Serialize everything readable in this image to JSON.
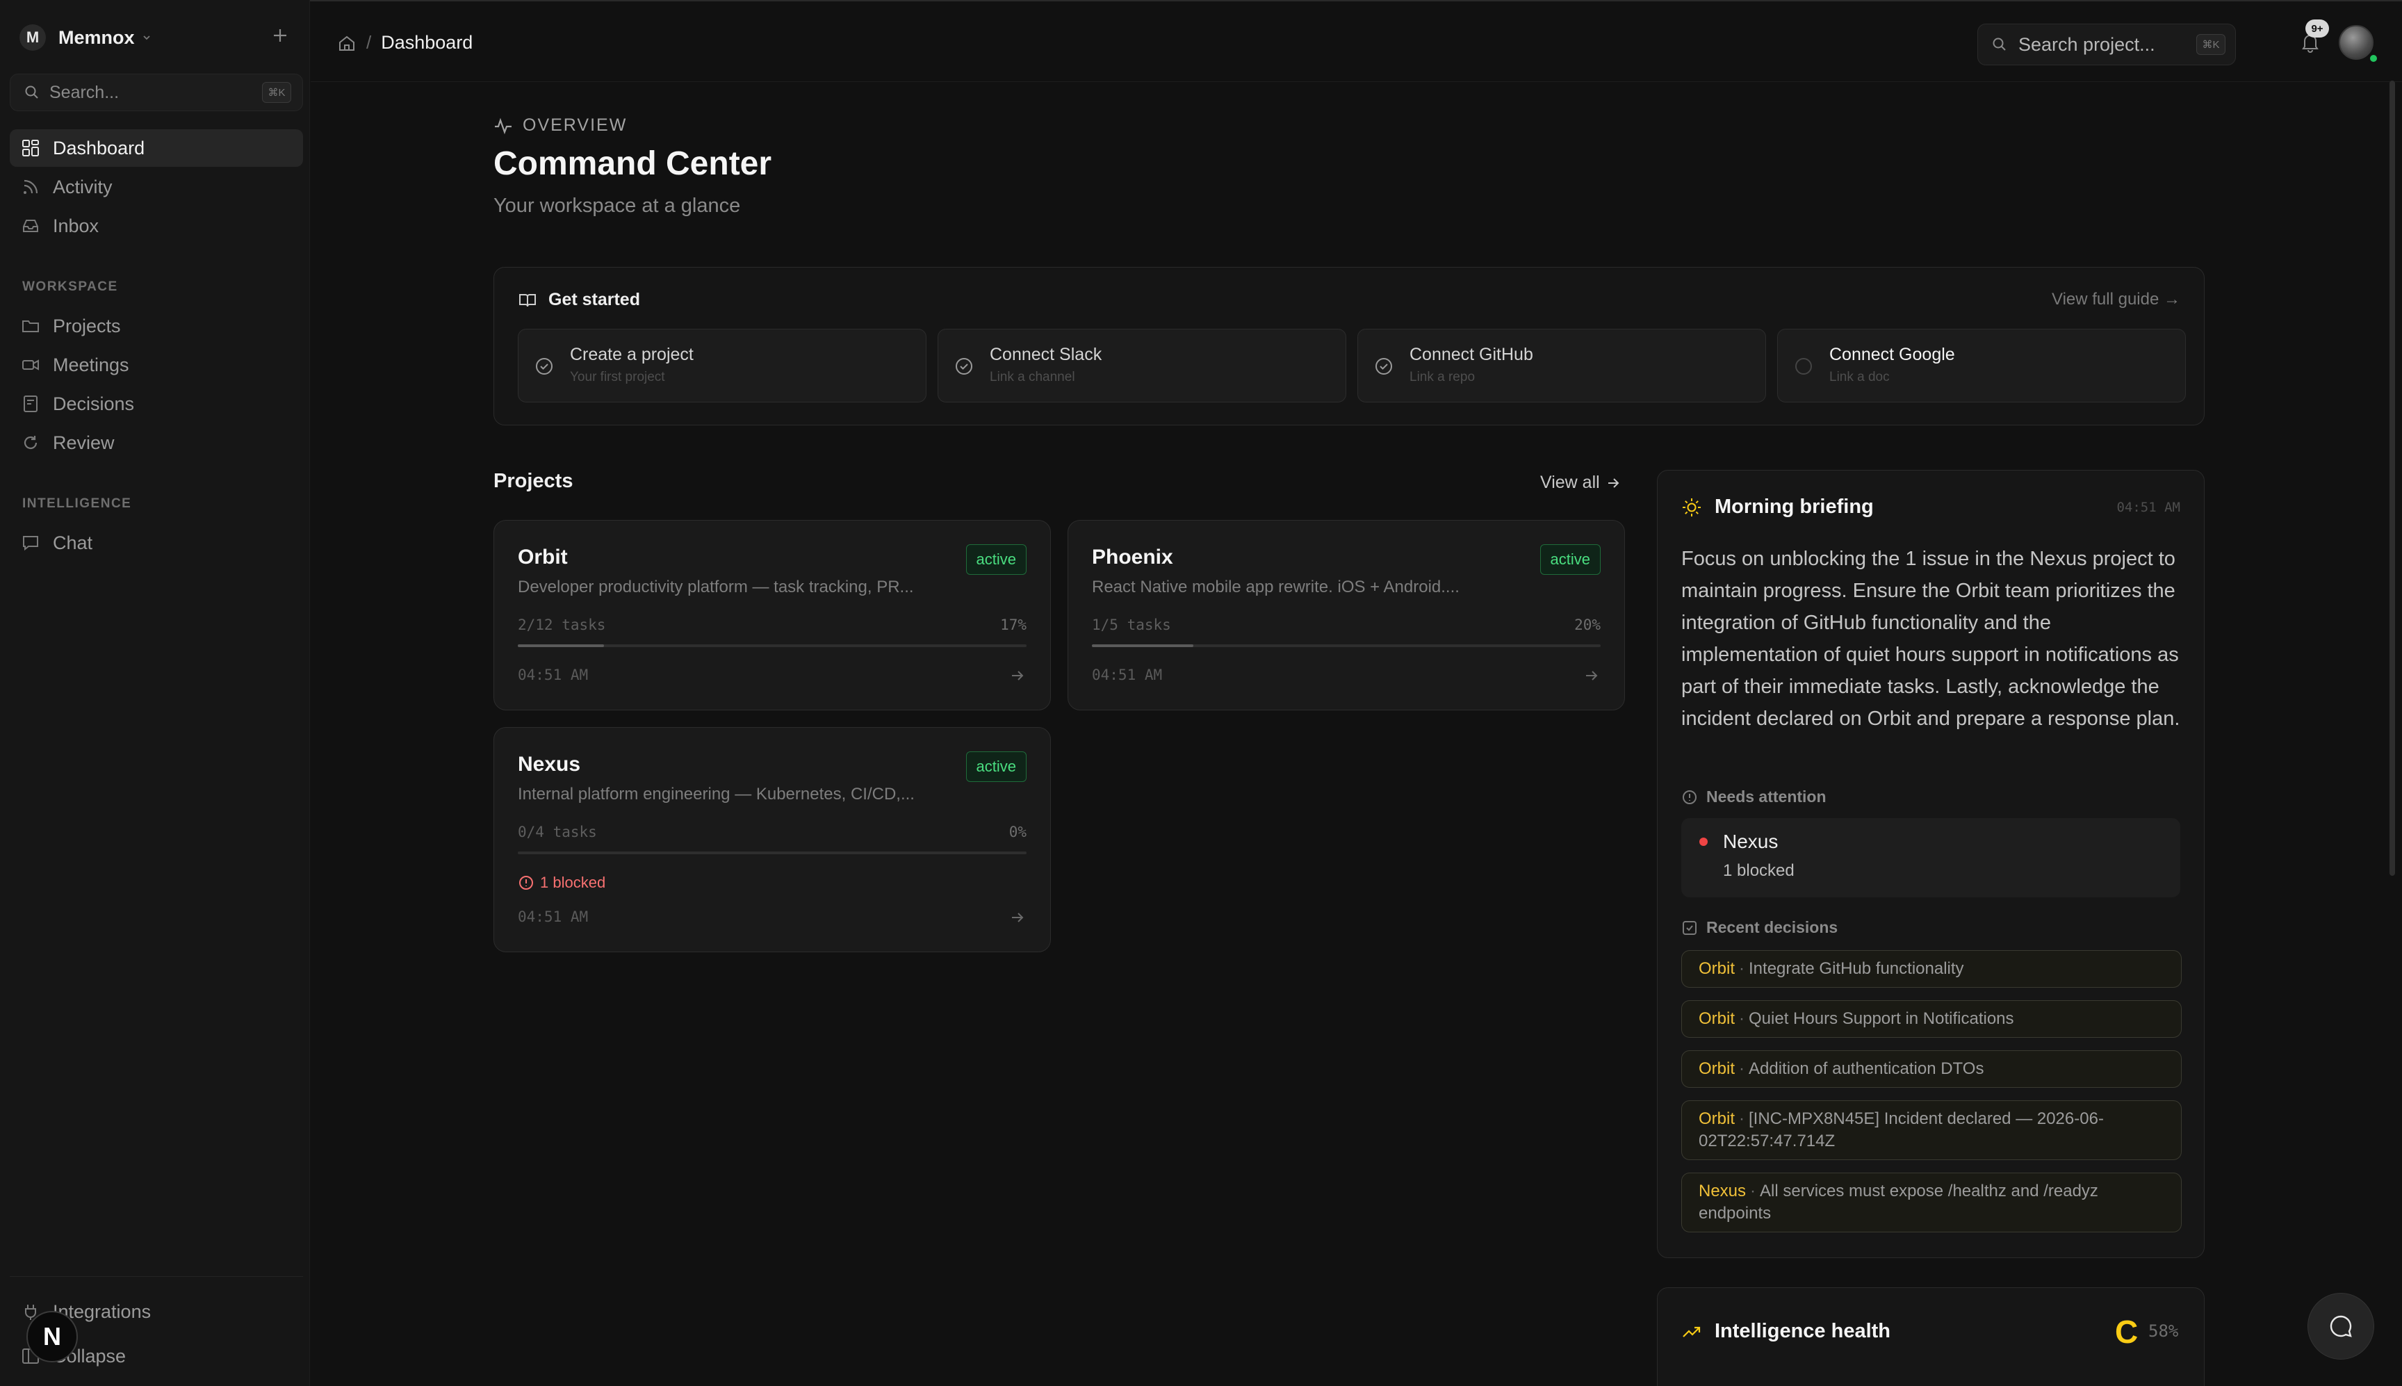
{
  "workspace": {
    "initial": "M",
    "name": "Memnox"
  },
  "sidebar": {
    "search_placeholder": "Search...",
    "search_shortcut": "⌘K",
    "primary": [
      {
        "label": "Dashboard",
        "icon": "grid-icon",
        "active": true
      },
      {
        "label": "Activity",
        "icon": "rss-icon"
      },
      {
        "label": "Inbox",
        "icon": "inbox-icon"
      }
    ],
    "workspace_label": "WORKSPACE",
    "workspace_items": [
      {
        "label": "Projects",
        "icon": "folder-icon"
      },
      {
        "label": "Meetings",
        "icon": "video-icon"
      },
      {
        "label": "Decisions",
        "icon": "bookmark-icon"
      },
      {
        "label": "Review",
        "icon": "refresh-icon"
      }
    ],
    "intelligence_label": "INTELLIGENCE",
    "intelligence_items": [
      {
        "label": "Chat",
        "icon": "message-icon"
      }
    ],
    "footer": {
      "integrations": "Integrations",
      "collapse": "Collapse"
    }
  },
  "topbar": {
    "breadcrumb_current": "Dashboard",
    "search_placeholder": "Search project...",
    "search_shortcut": "⌘K",
    "notification_count": "9+"
  },
  "header": {
    "eyebrow": "OVERVIEW",
    "title": "Command Center",
    "subtitle": "Your workspace at a glance"
  },
  "get_started": {
    "title": "Get started",
    "guide_link": "View full guide →",
    "steps": [
      {
        "title": "Create a project",
        "subtitle": "Your first project",
        "done": true
      },
      {
        "title": "Connect Slack",
        "subtitle": "Link a channel",
        "done": true
      },
      {
        "title": "Connect GitHub",
        "subtitle": "Link a repo",
        "done": true
      },
      {
        "title": "Connect Google",
        "subtitle": "Link a doc",
        "done": false
      }
    ]
  },
  "projects": {
    "title": "Projects",
    "view_all": "View all",
    "items": [
      {
        "name": "Orbit",
        "status": "active",
        "description": "Developer productivity platform — task tracking, PR...",
        "tasks": "2/12 tasks",
        "percent": "17%",
        "progress": 0.17,
        "time": "04:51 AM"
      },
      {
        "name": "Phoenix",
        "status": "active",
        "description": "React Native mobile app rewrite. iOS + Android....",
        "tasks": "1/5 tasks",
        "percent": "20%",
        "progress": 0.2,
        "time": "04:51 AM"
      },
      {
        "name": "Nexus",
        "status": "active",
        "description": "Internal platform engineering — Kubernetes, CI/CD,...",
        "tasks": "0/4 tasks",
        "percent": "0%",
        "progress": 0,
        "blocked": "1 blocked",
        "time": "04:51 AM"
      }
    ]
  },
  "briefing": {
    "title": "Morning briefing",
    "time": "04:51 AM",
    "text": "Focus on unblocking the 1 issue in the Nexus project to maintain progress. Ensure the Orbit team prioritizes the integration of GitHub functionality and the implementation of quiet hours support in notifications as part of their immediate tasks. Lastly, acknowledge the incident declared on Orbit and prepare a response plan.",
    "attention_label": "Needs attention",
    "attention": {
      "name": "Nexus",
      "detail": "1 blocked"
    },
    "decisions_label": "Recent decisions",
    "decisions": [
      {
        "project": "Orbit",
        "text": "Integrate GitHub functionality"
      },
      {
        "project": "Orbit",
        "text": "Quiet Hours Support in Notifications"
      },
      {
        "project": "Orbit",
        "text": "Addition of authentication DTOs"
      },
      {
        "project": "Orbit",
        "text": "[INC-MPX8N45E] Incident declared — 2026-06-02T22:57:47.714Z"
      },
      {
        "project": "Nexus",
        "text": "All services must expose /healthz and /readyz endpoints"
      }
    ]
  },
  "health": {
    "title": "Intelligence health",
    "grade": "C",
    "percent": "58%"
  },
  "dev_badge": "N",
  "colors": {
    "accent_active": "#4ade80",
    "decision_project": "#f0c038",
    "blocked": "#f87171",
    "grade": "#facc15"
  }
}
